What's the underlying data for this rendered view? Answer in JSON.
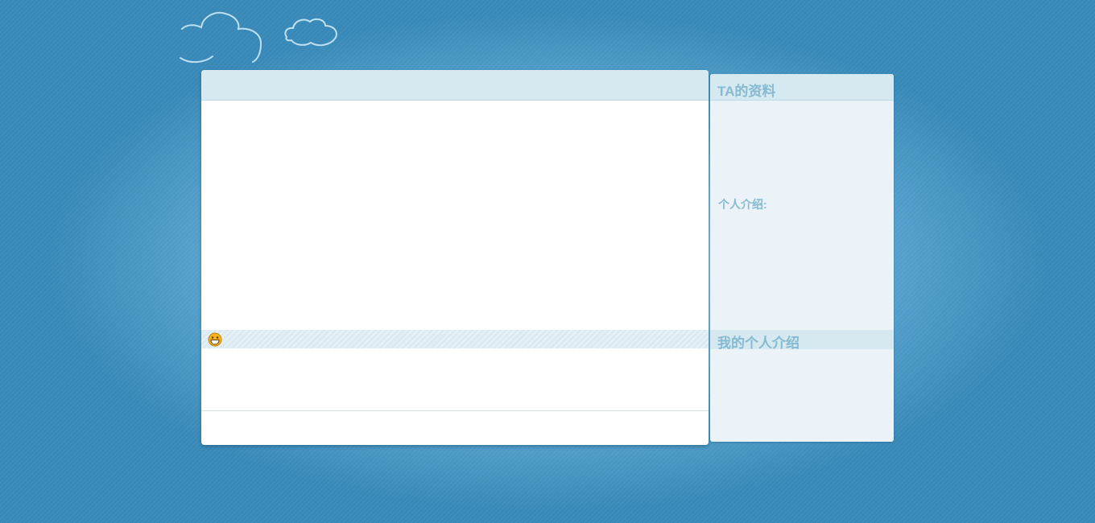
{
  "sidebar": {
    "title": "TA的资料",
    "intro_label": "个人介绍:",
    "my_intro_title": "我的个人介绍"
  },
  "icons": {
    "emoji": "smiley-face-icon",
    "decoration": "cloud-icon"
  },
  "colors": {
    "background": "#3889b8",
    "background_center": "#a4d1e8",
    "panel_header": "#d6e8f0",
    "sidebar_bg": "#ebf2f8",
    "title_text": "#86bad2",
    "emoji_fill": "#f6b51e"
  }
}
